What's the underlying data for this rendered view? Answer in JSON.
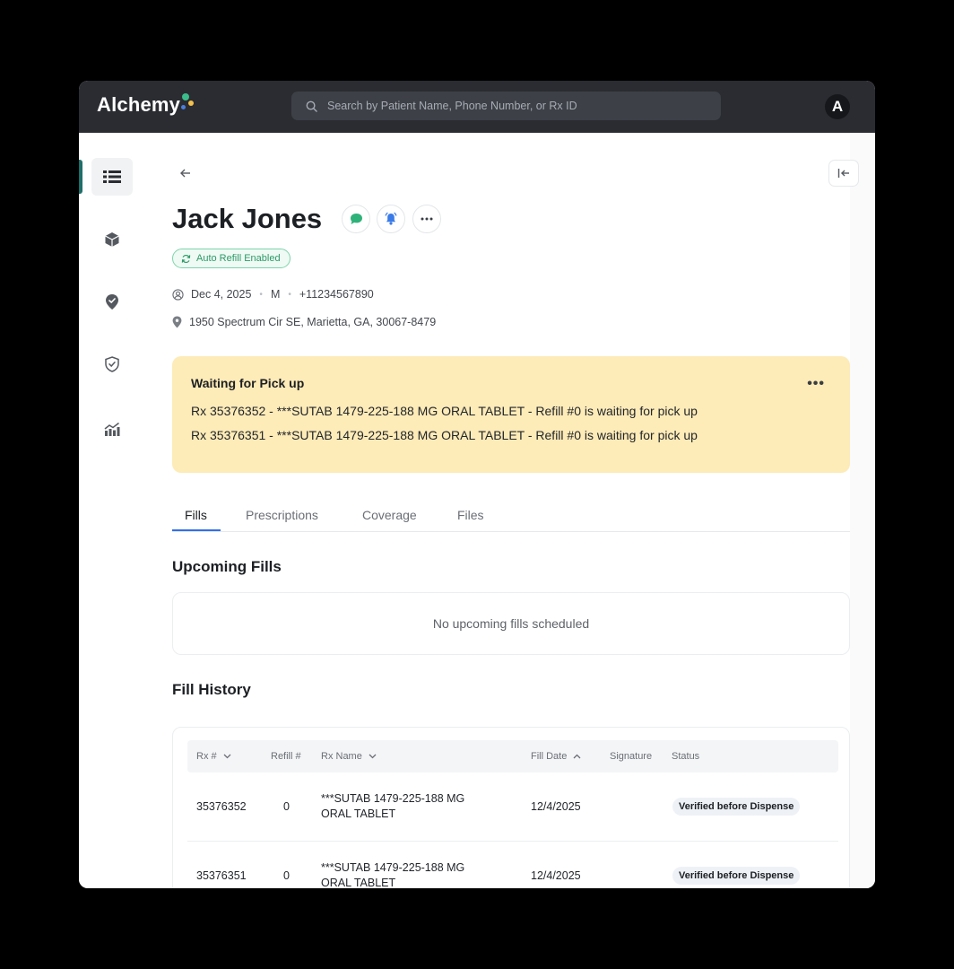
{
  "app": {
    "brand": "Alchemy",
    "search_placeholder": "Search by Patient Name, Phone Number, or Rx ID",
    "avatar_initial": "A"
  },
  "sidebar": {
    "items": [
      {
        "icon": "list-icon",
        "active": true
      },
      {
        "icon": "box-icon",
        "active": false
      },
      {
        "icon": "map-pin-check-icon",
        "active": false
      },
      {
        "icon": "shield-check-icon",
        "active": false
      },
      {
        "icon": "chart-trend-icon",
        "active": false
      }
    ]
  },
  "patient": {
    "name": "Jack Jones",
    "badge": "Auto Refill Enabled",
    "dob": "Dec 4, 2025",
    "sex": "M",
    "phone": "+11234567890",
    "address": "1950 Spectrum Cir SE, Marietta, GA, 30067-8479"
  },
  "alert": {
    "title": "Waiting for Pick up",
    "lines": [
      "Rx 35376352 - ***SUTAB 1479-225-188 MG ORAL TABLET - Refill #0 is waiting for pick up",
      "Rx 35376351 - ***SUTAB 1479-225-188 MG ORAL TABLET - Refill #0 is waiting for pick up"
    ]
  },
  "tabs": [
    "Fills",
    "Prescriptions",
    "Coverage",
    "Files"
  ],
  "upcoming": {
    "title": "Upcoming Fills",
    "empty": "No upcoming fills scheduled"
  },
  "history": {
    "title": "Fill History",
    "columns": [
      "Rx #",
      "Refill #",
      "Rx Name",
      "Fill Date",
      "Signature",
      "Status"
    ],
    "rows": [
      {
        "rx": "35376352",
        "refill": "0",
        "name": "***SUTAB 1479-225-188 MG ORAL TABLET",
        "date": "12/4/2025",
        "signature": "",
        "status": "Verified before Dispense"
      },
      {
        "rx": "35376351",
        "refill": "0",
        "name": "***SUTAB 1479-225-188 MG ORAL TABLET",
        "date": "12/4/2025",
        "signature": "",
        "status": "Verified before Dispense"
      }
    ]
  },
  "colors": {
    "topbar": "#2a2c31",
    "alert_bg": "#fdebb8",
    "accent_teal": "#1f6f6b",
    "badge_green": "#2c9a68",
    "tab_underline": "#2f6fed"
  }
}
